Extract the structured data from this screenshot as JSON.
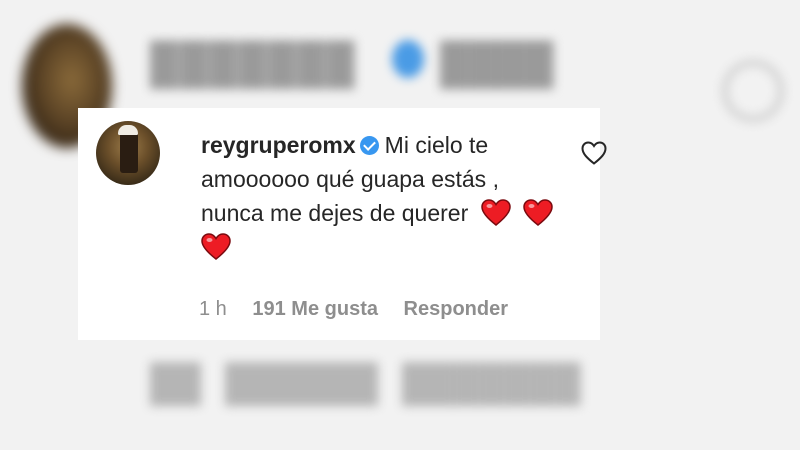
{
  "comment": {
    "username": "reygruperomx",
    "text_lines": [
      "Mi cielo te",
      "amoooooo qué guapa estás ,",
      "nunca me dejes de querer"
    ],
    "emoji": "red-heart"
  },
  "footer": {
    "time": "1 h",
    "likes": "191 Me gusta",
    "reply": "Responder"
  },
  "colors": {
    "text": "#262626",
    "meta": "#8e8e8e",
    "verified": "#3897f0",
    "heart": "#ed1c24"
  }
}
